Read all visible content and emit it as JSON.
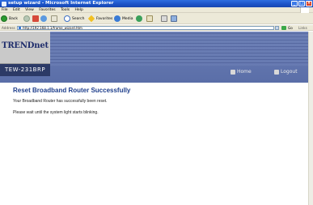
{
  "window": {
    "title": "setup wizard - Microsoft Internet Explorer",
    "controls": {
      "minimize": "_",
      "maximize": "□",
      "close": "×"
    }
  },
  "menu": [
    "File",
    "Edit",
    "View",
    "Favorites",
    "Tools",
    "Help"
  ],
  "toolbar": {
    "back": "Back",
    "search": "Search",
    "favorites": "Favorites",
    "media": "Media"
  },
  "address": {
    "label": "Address",
    "url": "http://192.168.1.1/frame_wizard.htm",
    "go": "Go",
    "links": "Links"
  },
  "brand": {
    "logo": "TRENDnet",
    "model": "TEW-231BRP",
    "nav_home": "Home",
    "nav_logout": "Logout"
  },
  "content": {
    "heading": "Reset Broadband Router Successfully",
    "message_1": "Your Broadband Router has successfully been reset.",
    "message_2": "Please wait until the system light starts blinking."
  },
  "colors": {
    "heading": "#1f3f8c",
    "header_bg": "#6c7fb5",
    "model_bar": "#2c3a66",
    "titlebar": "#1c54c8"
  }
}
